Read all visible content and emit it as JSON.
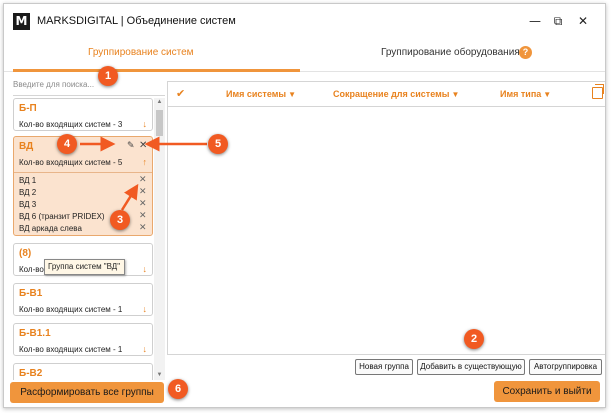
{
  "app": {
    "logo_letter": "M",
    "title": "MARKSDIGITAL | Объединение систем",
    "minimize": "—",
    "maximize": "⧉",
    "close": "✕"
  },
  "tabs": {
    "active": "Группирование систем",
    "inactive": "Группирование оборудования",
    "help": "?"
  },
  "search": {
    "placeholder": "Введите для поиска..."
  },
  "groups": [
    {
      "name": "Б-П",
      "count": "Кол-во входящих систем - 3",
      "arrow": "↓"
    },
    {
      "name": "ВД",
      "count": "Кол-во входящих систем - 5",
      "arrow": "↑",
      "members": [
        "ВД 1",
        "ВД 2",
        "ВД 3",
        "ВД 6 (транзит PRIDEX)",
        "ВД аркада слева"
      ]
    },
    {
      "name": "(8)",
      "count": "Кол-во",
      "arrow": "↓"
    },
    {
      "name": "Б-В1",
      "count": "Кол-во входящих систем - 1",
      "arrow": "↓"
    },
    {
      "name": "Б-В1.1",
      "count": "Кол-во входящих систем - 1",
      "arrow": "↓"
    },
    {
      "name": "Б-В2",
      "count": "",
      "arrow": ""
    }
  ],
  "tooltip": "Группа систем \"ВД\"",
  "table": {
    "columns": [
      "Имя системы",
      "Сокращение для системы",
      "Имя типа"
    ],
    "filter_icon": "▼"
  },
  "buttons": {
    "new_group": "Новая группа",
    "add_existing": "Добавить в существующую",
    "auto_group": "Автогруппировка",
    "disband_all": "Расформировать все группы",
    "save_exit": "Сохранить и выйти"
  },
  "annotations": [
    "1",
    "2",
    "3",
    "4",
    "5",
    "6"
  ],
  "colors": {
    "accent": "#e8821e",
    "button": "#f0953c",
    "badge": "#f15a22",
    "selected": "#fbe3cf"
  },
  "icons": {
    "edit": "✎",
    "remove": "✕",
    "check": "✔",
    "scroll_up": "▲",
    "scroll_down": "▼"
  }
}
